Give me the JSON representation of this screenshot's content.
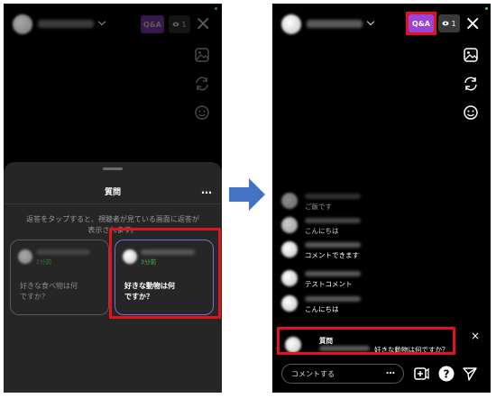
{
  "left_screen": {
    "header": {
      "qa_label": "Q&A",
      "viewer_count": "1"
    },
    "sheet": {
      "title": "質問",
      "menu": "…",
      "hint_line1": "返答をタップすると、視聴者が見ている画面に返答が",
      "hint_line2": "表示されます。",
      "questions": [
        {
          "time": "2分前",
          "text_line1": "好きな食べ物は何",
          "text_line2": "ですか？"
        },
        {
          "time": "3分前",
          "text_line1": "好きな動物は何",
          "text_line2": "ですか？"
        }
      ]
    }
  },
  "right_screen": {
    "header": {
      "qa_label": "Q&A",
      "viewer_count": "1"
    },
    "comments": [
      {
        "text": "ご飯です"
      },
      {
        "text": "こんにちは"
      },
      {
        "text": "コメントできます"
      },
      {
        "text": "テストコメント"
      },
      {
        "text": "こんにちは"
      }
    ],
    "question_banner": {
      "label": "質問",
      "text": "好きな動物は何ですか？",
      "close": "×"
    },
    "composer": {
      "placeholder": "コメントする",
      "more": "…"
    }
  },
  "icons": {
    "close": "close-icon",
    "photo": "photo-icon",
    "flip": "camera-flip-icon",
    "effects": "effects-icon",
    "eye": "eye-icon",
    "add_guest": "add-guest-icon",
    "question": "question-icon",
    "send": "send-icon"
  },
  "colors": {
    "qa_button": "#9b45d8",
    "highlight": "#e0131f",
    "arrow": "#4472c4",
    "time_green": "#4caf50",
    "card_border": "#7c6bd3",
    "live_dot": "#36d44b"
  }
}
